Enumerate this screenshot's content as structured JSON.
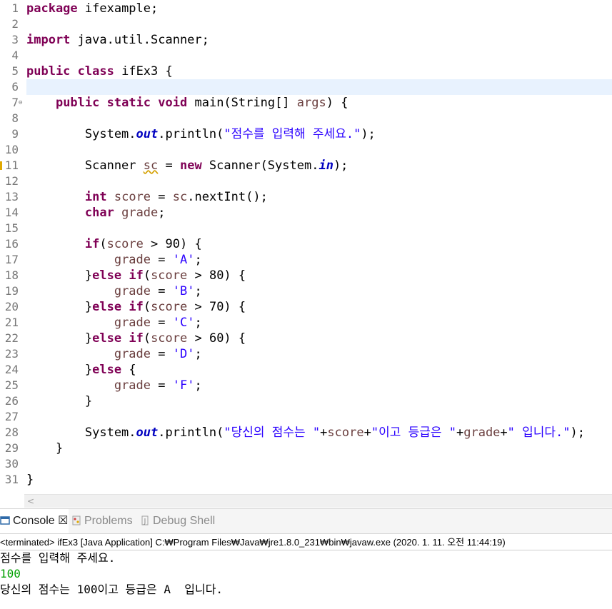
{
  "editor": {
    "line_numbers": [
      "1",
      "2",
      "3",
      "4",
      "5",
      "6",
      "7",
      "8",
      "9",
      "10",
      "11",
      "12",
      "13",
      "14",
      "15",
      "16",
      "17",
      "18",
      "19",
      "20",
      "21",
      "22",
      "23",
      "24",
      "25",
      "26",
      "27",
      "28",
      "29",
      "30",
      "31"
    ],
    "lines": [
      [
        {
          "t": "package",
          "c": "kw"
        },
        {
          "t": " ifexample;"
        }
      ],
      [],
      [
        {
          "t": "import",
          "c": "kw"
        },
        {
          "t": " java.util.Scanner;"
        }
      ],
      [],
      [
        {
          "t": "public",
          "c": "kw"
        },
        {
          "t": " "
        },
        {
          "t": "class",
          "c": "kw"
        },
        {
          "t": " ifEx3 {"
        }
      ],
      [],
      [
        {
          "t": "    "
        },
        {
          "t": "public",
          "c": "kw"
        },
        {
          "t": " "
        },
        {
          "t": "static",
          "c": "kw"
        },
        {
          "t": " "
        },
        {
          "t": "void",
          "c": "kw"
        },
        {
          "t": " main(String[] "
        },
        {
          "t": "args",
          "c": "var"
        },
        {
          "t": ") {"
        }
      ],
      [],
      [
        {
          "t": "        System."
        },
        {
          "t": "out",
          "c": "fld"
        },
        {
          "t": ".println("
        },
        {
          "t": "\"점수를 입력해 주세요.\"",
          "c": "str"
        },
        {
          "t": ");"
        }
      ],
      [],
      [
        {
          "t": "        Scanner "
        },
        {
          "t": "sc",
          "c": "var squig"
        },
        {
          "t": " = "
        },
        {
          "t": "new",
          "c": "kw"
        },
        {
          "t": " Scanner(System."
        },
        {
          "t": "in",
          "c": "fld"
        },
        {
          "t": ");"
        }
      ],
      [],
      [
        {
          "t": "        "
        },
        {
          "t": "int",
          "c": "kw"
        },
        {
          "t": " "
        },
        {
          "t": "score",
          "c": "var"
        },
        {
          "t": " = "
        },
        {
          "t": "sc",
          "c": "var"
        },
        {
          "t": ".nextInt();"
        }
      ],
      [
        {
          "t": "        "
        },
        {
          "t": "char",
          "c": "kw"
        },
        {
          "t": " "
        },
        {
          "t": "grade",
          "c": "var"
        },
        {
          "t": ";"
        }
      ],
      [],
      [
        {
          "t": "        "
        },
        {
          "t": "if",
          "c": "kw"
        },
        {
          "t": "("
        },
        {
          "t": "score",
          "c": "var"
        },
        {
          "t": " > 90) {"
        }
      ],
      [
        {
          "t": "            "
        },
        {
          "t": "grade",
          "c": "var"
        },
        {
          "t": " = "
        },
        {
          "t": "'A'",
          "c": "str"
        },
        {
          "t": ";"
        }
      ],
      [
        {
          "t": "        }"
        },
        {
          "t": "else",
          "c": "kw"
        },
        {
          "t": " "
        },
        {
          "t": "if",
          "c": "kw"
        },
        {
          "t": "("
        },
        {
          "t": "score",
          "c": "var"
        },
        {
          "t": " > 80) {"
        }
      ],
      [
        {
          "t": "            "
        },
        {
          "t": "grade",
          "c": "var"
        },
        {
          "t": " = "
        },
        {
          "t": "'B'",
          "c": "str"
        },
        {
          "t": ";"
        }
      ],
      [
        {
          "t": "        }"
        },
        {
          "t": "else",
          "c": "kw"
        },
        {
          "t": " "
        },
        {
          "t": "if",
          "c": "kw"
        },
        {
          "t": "("
        },
        {
          "t": "score",
          "c": "var"
        },
        {
          "t": " > 70) {"
        }
      ],
      [
        {
          "t": "            "
        },
        {
          "t": "grade",
          "c": "var"
        },
        {
          "t": " = "
        },
        {
          "t": "'C'",
          "c": "str"
        },
        {
          "t": ";"
        }
      ],
      [
        {
          "t": "        }"
        },
        {
          "t": "else",
          "c": "kw"
        },
        {
          "t": " "
        },
        {
          "t": "if",
          "c": "kw"
        },
        {
          "t": "("
        },
        {
          "t": "score",
          "c": "var"
        },
        {
          "t": " > 60) {"
        }
      ],
      [
        {
          "t": "            "
        },
        {
          "t": "grade",
          "c": "var"
        },
        {
          "t": " = "
        },
        {
          "t": "'D'",
          "c": "str"
        },
        {
          "t": ";"
        }
      ],
      [
        {
          "t": "        }"
        },
        {
          "t": "else",
          "c": "kw"
        },
        {
          "t": " {"
        }
      ],
      [
        {
          "t": "            "
        },
        {
          "t": "grade",
          "c": "var"
        },
        {
          "t": " = "
        },
        {
          "t": "'F'",
          "c": "str"
        },
        {
          "t": ";"
        }
      ],
      [
        {
          "t": "        }"
        }
      ],
      [],
      [
        {
          "t": "        System."
        },
        {
          "t": "out",
          "c": "fld"
        },
        {
          "t": ".println("
        },
        {
          "t": "\"당신의 점수는 \"",
          "c": "str"
        },
        {
          "t": "+"
        },
        {
          "t": "score",
          "c": "var"
        },
        {
          "t": "+"
        },
        {
          "t": "\"이고 등급은 \"",
          "c": "str"
        },
        {
          "t": "+"
        },
        {
          "t": "grade",
          "c": "var"
        },
        {
          "t": "+"
        },
        {
          "t": "\" 입니다.\"",
          "c": "str"
        },
        {
          "t": ");"
        }
      ],
      [
        {
          "t": "    }"
        }
      ],
      [],
      [
        {
          "t": "}"
        }
      ]
    ],
    "current_line_index": 5,
    "fold_marker_line_index": 6,
    "warning_line_index": 10,
    "hscroll_arrow": "<"
  },
  "console": {
    "tabs": [
      {
        "label": "Console ☒",
        "icon": "console-icon",
        "active": true
      },
      {
        "label": "Problems",
        "icon": "problems-icon",
        "active": false
      },
      {
        "label": "Debug Shell",
        "icon": "debug-shell-icon",
        "active": false
      }
    ],
    "status": "<terminated> ifEx3 [Java Application] C:₩Program Files₩Java₩jre1.8.0_231₩bin₩javaw.exe (2020. 1. 11. 오전 11:44:19)",
    "output": [
      {
        "text": "점수를 입력해 주세요.",
        "kind": "out"
      },
      {
        "text": "100",
        "kind": "in"
      },
      {
        "text": "당신의 점수는 100이고 등급은 A  입니다.",
        "kind": "out"
      }
    ]
  },
  "colors": {
    "keyword": "#7f0055",
    "string": "#2a00ff",
    "field": "#0000c0",
    "local_var": "#6a3e3e",
    "current_line": "#e8f2fe",
    "stdin": "#00a000"
  }
}
